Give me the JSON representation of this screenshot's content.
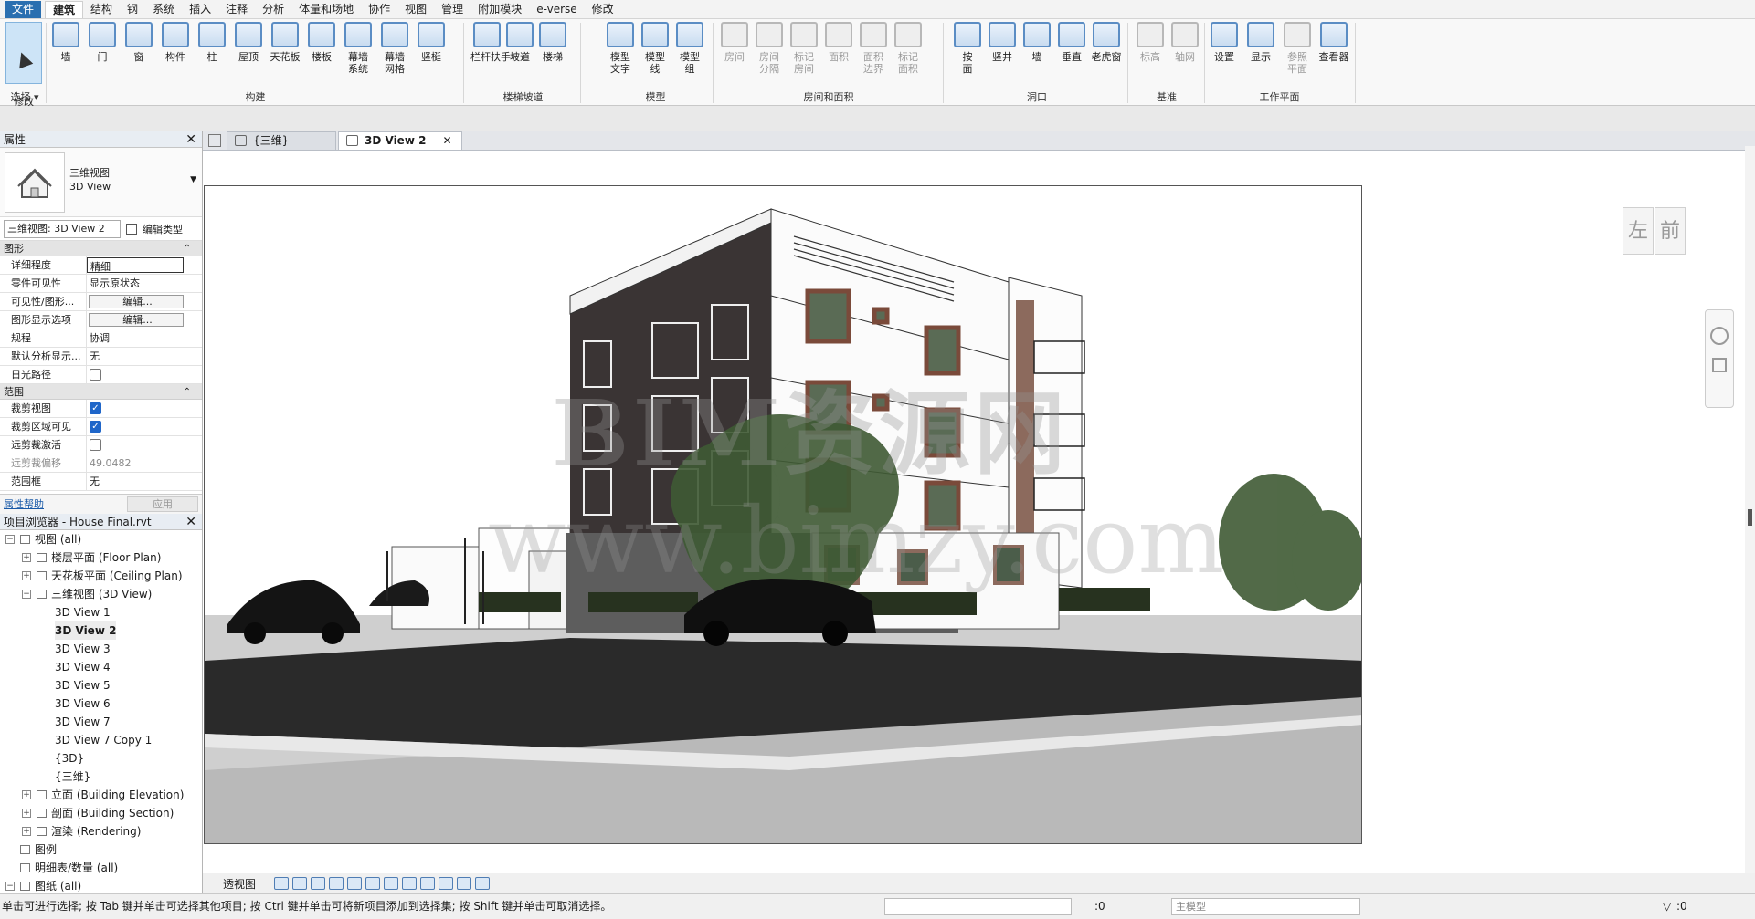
{
  "menu": {
    "items": [
      "文件",
      "建筑",
      "结构",
      "钢",
      "系统",
      "插入",
      "注释",
      "分析",
      "体量和场地",
      "协作",
      "视图",
      "管理",
      "附加模块",
      "e-verse",
      "修改"
    ]
  },
  "ribbon": {
    "modify": "修改",
    "select_group": "选择",
    "build_buttons": [
      "墙",
      "门",
      "窗",
      "构件",
      "柱",
      "屋顶",
      "天花板",
      "楼板",
      "幕墙\n系统",
      "幕墙\n网格",
      "竖梃"
    ],
    "build_group": "构建",
    "stair_buttons": [
      "栏杆扶手",
      "坡道",
      "楼梯"
    ],
    "stair_group": "楼梯坡道",
    "model_buttons": [
      "模型\n文字",
      "模型\n线",
      "模型\n组"
    ],
    "model_group": "模型",
    "room_buttons": [
      "房间",
      "房间\n分隔",
      "标记\n房间",
      "面积",
      "面积\n边界",
      "标记\n面积"
    ],
    "room_group": "房间和面积",
    "opening_buttons": [
      "按\n面",
      "竖井",
      "墙",
      "垂直",
      "老虎窗"
    ],
    "opening_group": "洞口",
    "datum_buttons": [
      "标高",
      "轴网"
    ],
    "datum_group": "基准",
    "workplane_buttons": [
      "设置",
      "显示",
      "参照\n平面",
      "查看器"
    ],
    "workplane_group": "工作平面"
  },
  "properties": {
    "title": "属性",
    "type_line1": "三维视图",
    "type_line2": "3D View",
    "selector": "三维视图: 3D View 2",
    "edit_type": "编辑类型",
    "section_graphics": "图形",
    "graphics_rows": [
      {
        "name": "详细程度",
        "value": "精细"
      },
      {
        "name": "零件可见性",
        "value": "显示原状态"
      },
      {
        "name": "可见性/图形...",
        "value": "编辑..."
      },
      {
        "name": "图形显示选项",
        "value": "编辑..."
      },
      {
        "name": "规程",
        "value": "协调"
      },
      {
        "name": "默认分析显示...",
        "value": "无"
      },
      {
        "name": "日光路径",
        "value": ""
      }
    ],
    "section_extents": "范围",
    "extent_rows": [
      {
        "name": "裁剪视图",
        "value": ""
      },
      {
        "name": "裁剪区域可见",
        "value": ""
      },
      {
        "name": "远剪裁激活",
        "value": ""
      },
      {
        "name": "远剪裁偏移",
        "value": "49.0482"
      },
      {
        "name": "范围框",
        "value": "无"
      }
    ],
    "help_link": "属性帮助",
    "apply": "应用"
  },
  "browser": {
    "title": "项目浏览器 - House Final.rvt",
    "items": [
      {
        "label": "视图 (all)",
        "level": 0,
        "toggle": "−"
      },
      {
        "label": "楼层平面 (Floor Plan)",
        "level": 1,
        "toggle": "+"
      },
      {
        "label": "天花板平面 (Ceiling Plan)",
        "level": 1,
        "toggle": "+"
      },
      {
        "label": "三维视图 (3D View)",
        "level": 1,
        "toggle": "−"
      },
      {
        "label": "3D View 1",
        "level": 2,
        "toggle": ""
      },
      {
        "label": "3D View 2",
        "level": 2,
        "toggle": "",
        "active": true
      },
      {
        "label": "3D View 3",
        "level": 2,
        "toggle": ""
      },
      {
        "label": "3D View 4",
        "level": 2,
        "toggle": ""
      },
      {
        "label": "3D View 5",
        "level": 2,
        "toggle": ""
      },
      {
        "label": "3D View 6",
        "level": 2,
        "toggle": ""
      },
      {
        "label": "3D View 7",
        "level": 2,
        "toggle": ""
      },
      {
        "label": "3D View 7 Copy 1",
        "level": 2,
        "toggle": ""
      },
      {
        "label": "{3D}",
        "level": 2,
        "toggle": ""
      },
      {
        "label": "{三维}",
        "level": 2,
        "toggle": ""
      },
      {
        "label": "立面 (Building Elevation)",
        "level": 1,
        "toggle": "+"
      },
      {
        "label": "剖面 (Building Section)",
        "level": 1,
        "toggle": "+"
      },
      {
        "label": "渲染 (Rendering)",
        "level": 1,
        "toggle": "+"
      },
      {
        "label": "图例",
        "level": 0,
        "toggle": ""
      },
      {
        "label": "明细表/数量 (all)",
        "level": 0,
        "toggle": ""
      },
      {
        "label": "图纸 (all)",
        "level": 0,
        "toggle": "−"
      }
    ]
  },
  "view_tabs": [
    {
      "label": "{三维}",
      "active": false
    },
    {
      "label": "3D View 2",
      "active": true
    }
  ],
  "viewcube": {
    "left": "左",
    "front": "前"
  },
  "watermark": {
    "line1": "BIM资源网",
    "line2": "www.bimzy.com"
  },
  "view_control": {
    "mode": "透视图"
  },
  "status": {
    "message": "单击可进行选择; 按 Tab 键并单击可选择其他项目; 按 Ctrl 键并单击可将新项目添加到选择集; 按 Shift 键并单击可取消选择。",
    "coord": ":0",
    "model": "主模型",
    "filter": ":0"
  }
}
